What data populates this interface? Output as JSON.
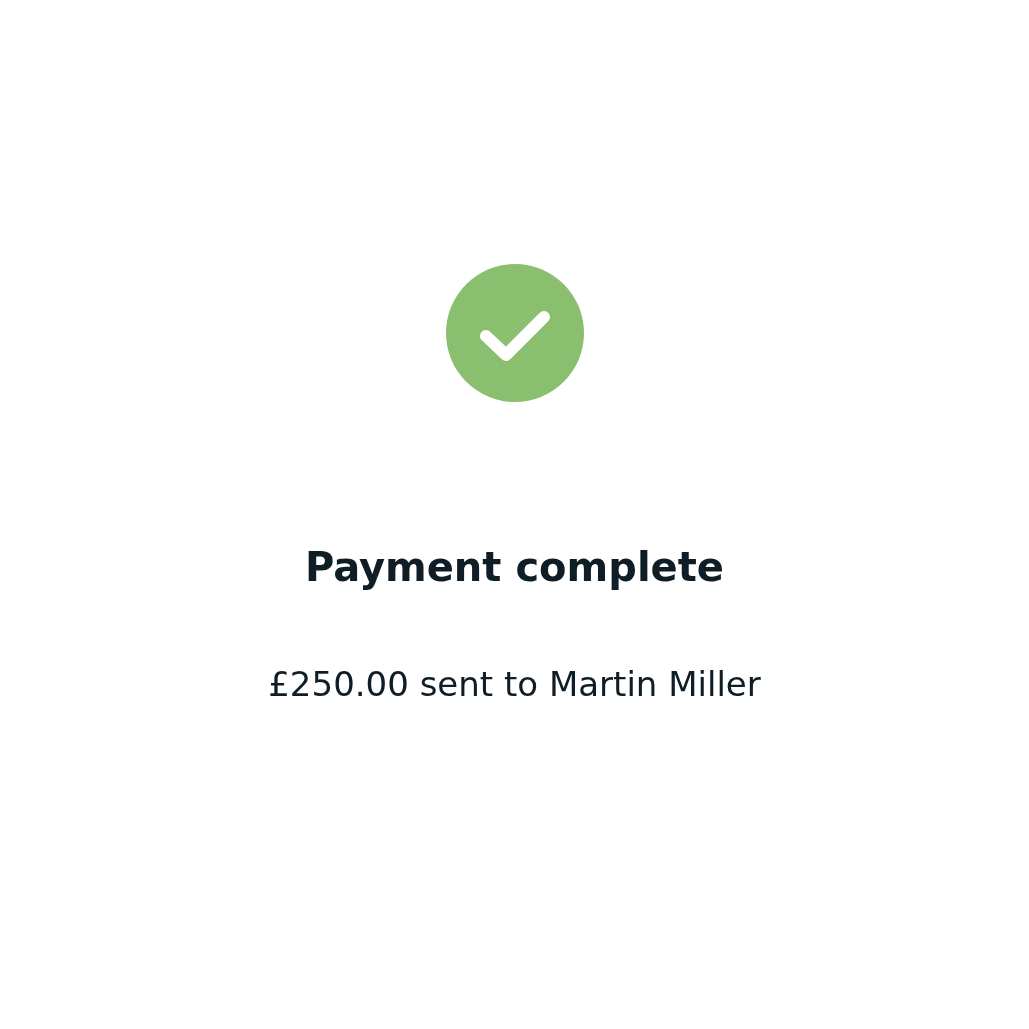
{
  "status": {
    "kind": "success"
  },
  "title": "Payment complete",
  "message": "£250.00 sent to Martin Miller"
}
